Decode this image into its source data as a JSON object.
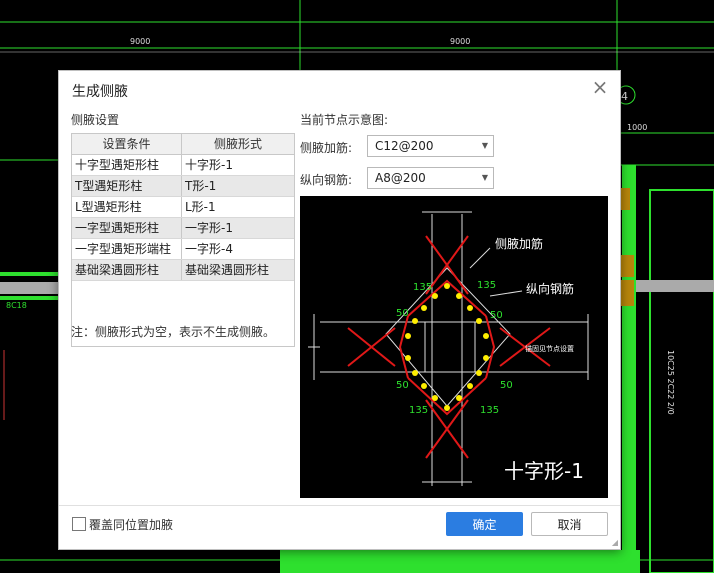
{
  "cad": {
    "dim_left": "9000",
    "dim_right": "9000",
    "dim_small": "1000",
    "side_label_left": "8C18",
    "side_label_right": "10C25 2C22 2/0",
    "axis_number": "4"
  },
  "dialog": {
    "title": "生成侧腋",
    "section_label": "侧腋设置",
    "table": {
      "headers": [
        "设置条件",
        "侧腋形式"
      ],
      "rows": [
        [
          "十字型遇矩形柱",
          "十字形-1"
        ],
        [
          "T型遇矩形柱",
          "T形-1"
        ],
        [
          "L型遇矩形柱",
          "L形-1"
        ],
        [
          "一字型遇矩形柱",
          "一字形-1"
        ],
        [
          "一字型遇矩形端柱",
          "一字形-4"
        ],
        [
          "基础梁遇圆形柱",
          "基础梁遇圆形柱"
        ]
      ]
    },
    "note": "注：侧腋形式为空，表示不生成侧腋。",
    "preview_title": "当前节点示意图:",
    "rebar_label": "侧腋加筋:",
    "rebar_value": "C12@200",
    "long_label": "纵向钢筋:",
    "long_value": "A8@200",
    "preview": {
      "callout_rebar": "侧腋加筋",
      "callout_long": "纵向钢筋",
      "anchor_note": "锚固见节点设置",
      "dim_50": "50",
      "dim_135": "135",
      "caption": "十字形-1"
    },
    "overwrite_label": "覆盖同位置加腋",
    "ok_label": "确定",
    "cancel_label": "取消"
  }
}
